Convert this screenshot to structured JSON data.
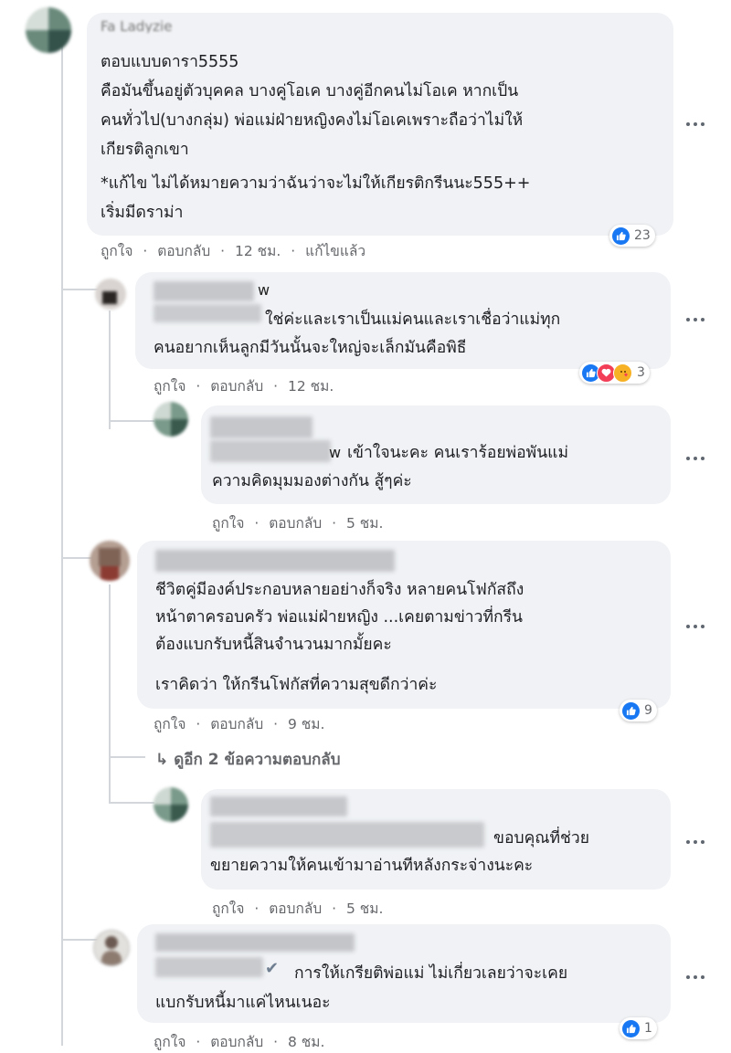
{
  "comments": [
    {
      "name_fragment": "Fa Ladyzie",
      "text_lines": [
        "ตอบแบบดารา5555",
        "คือมันขึ้นอยู่ตัวบุคคล บางคู่โอเค บางคู่อีกคนไม่โอเค หากเป็น",
        "คนทั่วไป(บางกลุ่ม) พ่อแม่ฝ่ายหญิงคงไม่โอเคเพราะถือว่าไม่ให้",
        "เกียรติลูกเขา",
        "*แก้ไข ไม่ได้หมายความว่าฉันว่าจะไม่ให้เกียรติกรีนนะ555++",
        "เริ่มมีดราม่า"
      ],
      "like": "ถูกใจ",
      "reply": "ตอบกลับ",
      "time": "12 ชม.",
      "edited": "แก้ไขแล้ว",
      "reaction_count": "23"
    },
    {
      "name_fragment": "w",
      "text_lines": [
        "ใช่ค่ะและเราเป็นแม่คนและเราเชื่อว่าแม่ทุก",
        "คนอยากเห็นลูกมีวันนั้นจะใหญ่จะเล็กมันคือพิธี"
      ],
      "like": "ถูกใจ",
      "reply": "ตอบกลับ",
      "time": "12 ชม.",
      "reaction_count": "3"
    },
    {
      "name_fragment": "w",
      "text_lines": [
        "เข้าใจนะคะ คนเราร้อยพ่อพันแม่",
        "ความคิดมุมมองต่างกัน สู้ๆค่ะ"
      ],
      "like": "ถูกใจ",
      "reply": "ตอบกลับ",
      "time": "5 ชม."
    },
    {
      "text_lines": [
        "ชีวิตคู่มีองค์ประกอบหลายอย่างก็จริง หลายคนโฟกัสถึง",
        "หน้าตาครอบครัว พ่อแม่ฝ่ายหญิง ...เคยตามข่าวที่กรีน",
        "ต้องแบกรับหนี้สินจำนวนมากมั้ยคะ",
        "เราคิดว่า ให้กรีนโฟกัสที่ความสุขดีกว่าค่ะ"
      ],
      "like": "ถูกใจ",
      "reply": "ตอบกลับ",
      "time": "9 ชม.",
      "reaction_count": "9"
    },
    {
      "text_lines": [
        "ขอบคุณที่ช่วย",
        "ขยายความให้คนเข้ามาอ่านทีหลังกระจ่างนะคะ"
      ],
      "like": "ถูกใจ",
      "reply": "ตอบกลับ",
      "time": "5 ชม."
    },
    {
      "text_lines": [
        "การให้เกรียติพ่อแม่ ไม่เกี่ยวเลยว่าจะเคย",
        "แบกรับหนี้มาแค่ไหนเนอะ"
      ],
      "like": "ถูกใจ",
      "reply": "ตอบกลับ",
      "time": "8 ชม.",
      "reaction_count": "1"
    }
  ],
  "view_more_replies": "ดูอีก 2 ข้อความตอบกลับ",
  "separator": "·",
  "reply_arrow": "↳",
  "verified_mark": "✔",
  "icons": {
    "more": "more-horizontal-icon",
    "like": "like-icon",
    "care": "care-emoji-icon",
    "love": "love-emoji-icon"
  },
  "colors": {
    "bubble": "#f0f2f5",
    "meta_text": "#65676b",
    "like_blue": "#1877f2",
    "love_red": "#f33e58",
    "care_yellow": "#f7b125"
  }
}
